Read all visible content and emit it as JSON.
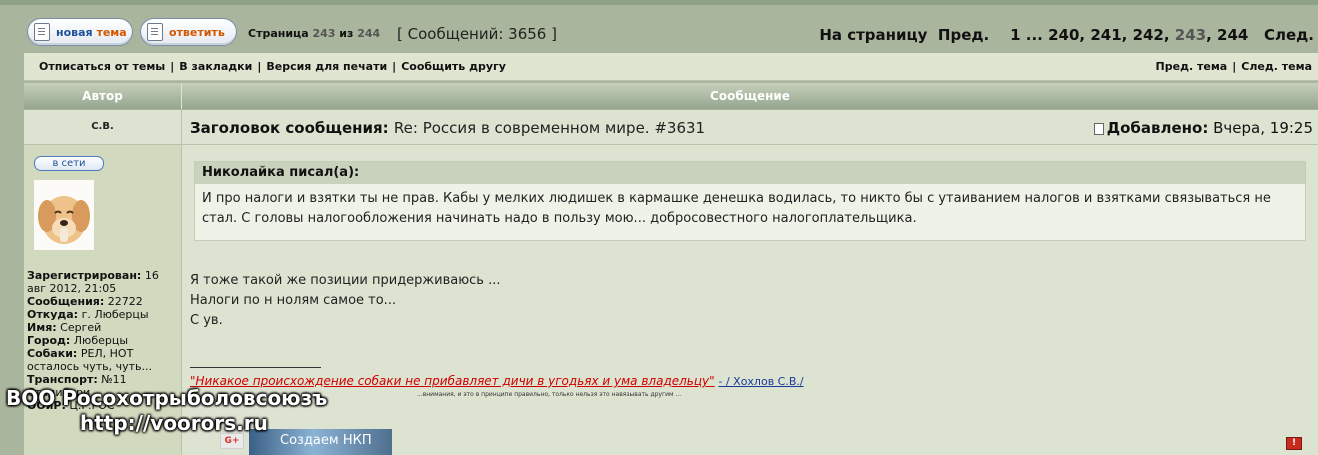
{
  "toolbar": {
    "new_topic_prefix": "новая",
    "new_topic_suffix": "тема",
    "reply_label": "ответить",
    "page_word": "Страница",
    "page_current": "243",
    "page_of": "из",
    "page_total": "244",
    "messages_text": "[ Сообщений: 3656 ]"
  },
  "pagination": {
    "label": "На страницу",
    "prev": "Пред.",
    "first": "1",
    "ellipsis": "...",
    "pages": [
      "240",
      "241",
      "242"
    ],
    "current": "243",
    "last": "244",
    "next": "След."
  },
  "links": {
    "unsubscribe": "Отписаться от темы",
    "bookmarks": "В закладки",
    "print": "Версия для печати",
    "tell_friend": "Сообщить другу",
    "prev_topic": "Пред. тема",
    "next_topic": "След. тема",
    "separator": "|"
  },
  "table_header": {
    "author": "Автор",
    "message": "Сообщение"
  },
  "post": {
    "author_name": "С.В.",
    "subject_label": "Заголовок сообщения:",
    "subject": "Re: Россия в современном мире. #3631",
    "added_label": "Добавлено:",
    "added_value": "Вчера, 19:25",
    "online_badge": "в сети",
    "profile": [
      {
        "label": "Зарегистрирован:",
        "value": "16 авг 2012, 21:05"
      },
      {
        "label": "Сообщения:",
        "value": "22722"
      },
      {
        "label": "Откуда:",
        "value": "г. Люберцы"
      },
      {
        "label": "Имя:",
        "value": "Сергей"
      },
      {
        "label": "Город:",
        "value": "Люберцы"
      },
      {
        "label": "Собаки:",
        "value": "РЕЛ, НОТ осталось чуть, чуть..."
      },
      {
        "label": "Транспорт:",
        "value": "№11"
      },
      {
        "label": "",
        "value": "Стадибари"
      },
      {
        "label": "ООиР:",
        "value": "Ц.Р.РОС"
      }
    ],
    "quote_header": "Николайка писал(а):",
    "quote_text": "И про налоги и взятки ты не прав. Кабы у мелких людишек в кармашке денешка водилась, то никто бы с утаиванием налогов и взятками связываться не стал. С головы налогообложения начинать надо в пользу мою... добросовестного налогоплательщика.",
    "body_lines": [
      "Я тоже такой же позиции придерживаюсь ...",
      "Налоги по н нолям самое то...",
      "С ув."
    ],
    "signature_quote": "\"Никакое происхождение собаки не прибавляет дичи в угодьях и ума владельцу\"",
    "signature_author": "- / Хохлов С.В./",
    "signature_small": "...внимания, и это в принципе правильно, только нельзя это навязывать другим ...",
    "gplus_label": "G+",
    "banner_text": "Создаем НКП",
    "report_icon_label": "!"
  },
  "watermark": {
    "line1": "ВОО Росохотрыболовсоюзъ",
    "line2": "http://voorors.ru"
  }
}
